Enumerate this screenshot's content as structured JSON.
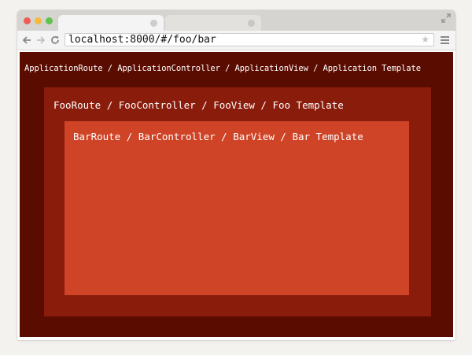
{
  "browser": {
    "url": "localhost:8000/#/foo/bar",
    "icons": {
      "back": "arrow-left-icon",
      "forward": "arrow-right-icon",
      "reload": "reload-icon",
      "bookmark": "star-icon",
      "menu": "hamburger-menu-icon",
      "fullscreen": "expand-icon"
    }
  },
  "layers": {
    "application": {
      "label": "ApplicationRoute / ApplicationController / ApplicationView / Application Template",
      "color": "#5a0c00"
    },
    "foo": {
      "label": "FooRoute / FooController / FooView / Foo Template",
      "color": "#8a1c0c"
    },
    "bar": {
      "label": "BarRoute / BarController / BarView / Bar Template",
      "color": "#cf4326"
    }
  }
}
